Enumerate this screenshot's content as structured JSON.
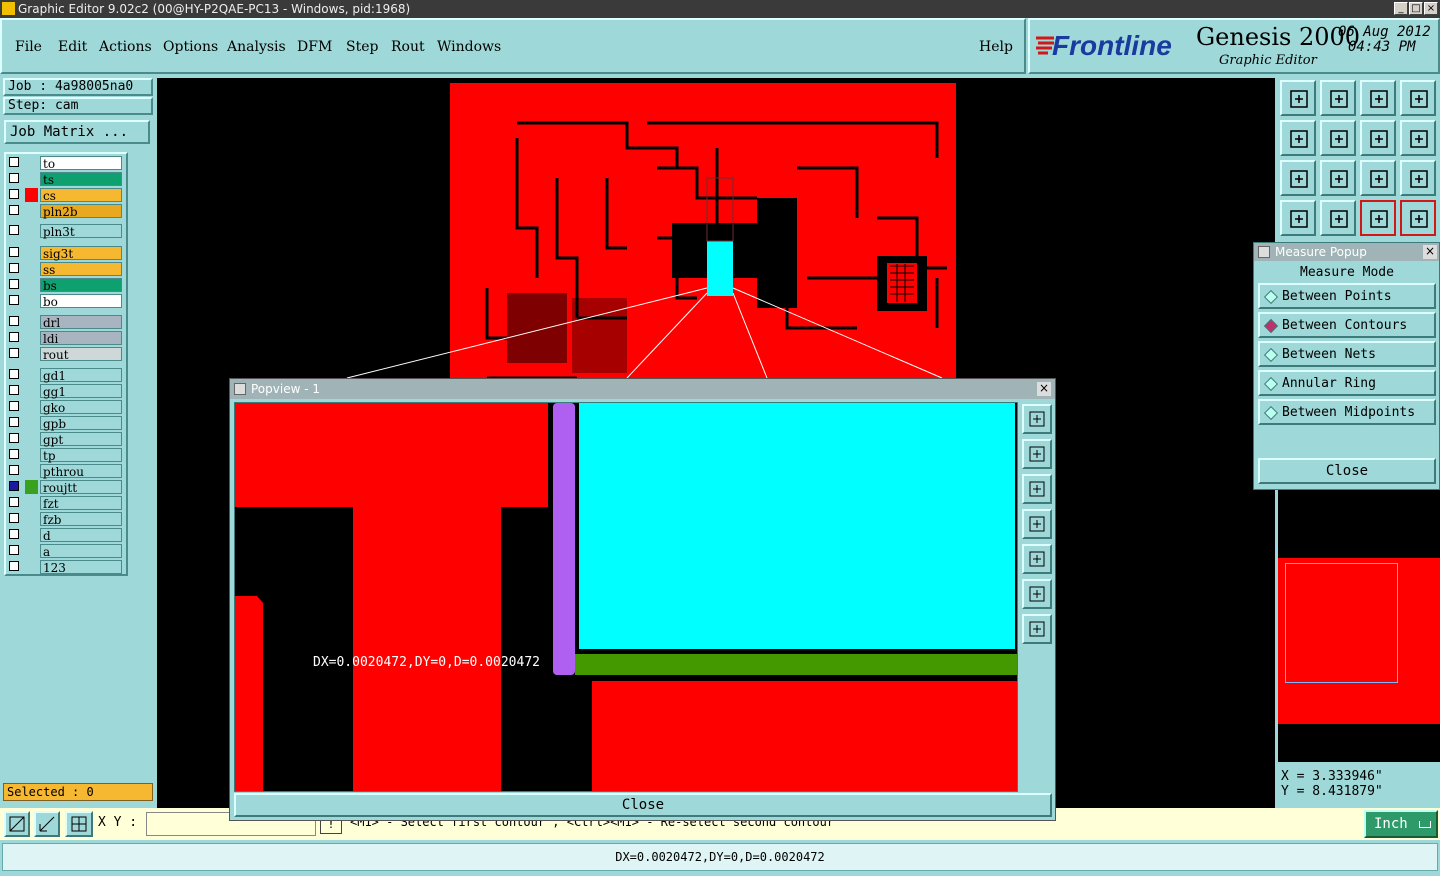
{
  "window": {
    "title": "Graphic Editor 9.02c2 (00@HY-P2QAE-PC13 - Windows, pid:1968)",
    "min": "_",
    "max": "□",
    "close": "×"
  },
  "menu": [
    "File",
    "Edit",
    "Actions",
    "Options",
    "Analysis",
    "DFM",
    "Step",
    "Rout",
    "Windows"
  ],
  "help": "Help",
  "brand": {
    "logo": "Frontline",
    "product": "Genesis 2000",
    "subtitle": "Graphic Editor",
    "date": "06 Aug 2012",
    "time": "04:43 PM"
  },
  "job": {
    "job": "Job : 4a98005na0",
    "step": "Step: cam",
    "matrix": "Job Matrix ..."
  },
  "layers": [
    {
      "name": "to",
      "color": "#ffffff",
      "ind": ""
    },
    {
      "name": "ts",
      "color": "#0fa070",
      "ind": ""
    },
    {
      "name": "cs",
      "color": "#f5b830",
      "ind": "#ff0000"
    },
    {
      "name": "pln2b",
      "color": "#e8a820",
      "ind": ""
    },
    {
      "name": "pln3t",
      "color": "#9fd8d8",
      "ind": ""
    },
    {
      "name": "sig3t",
      "color": "#f5b830",
      "ind": ""
    },
    {
      "name": "ss",
      "color": "#f5b830",
      "ind": ""
    },
    {
      "name": "bs",
      "color": "#0fa070",
      "ind": ""
    },
    {
      "name": "bo",
      "color": "#ffffff",
      "ind": ""
    },
    {
      "name": "drl",
      "color": "#a8b4c0",
      "ind": ""
    },
    {
      "name": "ldi",
      "color": "#a8b4c0",
      "ind": ""
    },
    {
      "name": "rout",
      "color": "#cfd8d8",
      "ind": ""
    },
    {
      "name": "gd1",
      "color": "#9fd8d8",
      "ind": ""
    },
    {
      "name": "gg1",
      "color": "#9fd8d8",
      "ind": ""
    },
    {
      "name": "gko",
      "color": "#9fd8d8",
      "ind": ""
    },
    {
      "name": "gpb",
      "color": "#9fd8d8",
      "ind": ""
    },
    {
      "name": "gpt",
      "color": "#9fd8d8",
      "ind": ""
    },
    {
      "name": "tp",
      "color": "#9fd8d8",
      "ind": ""
    },
    {
      "name": "pthrou",
      "color": "#9fd8d8",
      "ind": ""
    },
    {
      "name": "roujtt",
      "color": "#9fd8d8",
      "ind": "#3aa020"
    },
    {
      "name": "fzt",
      "color": "#9fd8d8",
      "ind": ""
    },
    {
      "name": "fzb",
      "color": "#9fd8d8",
      "ind": ""
    },
    {
      "name": "d",
      "color": "#9fd8d8",
      "ind": ""
    },
    {
      "name": "a",
      "color": "#9fd8d8",
      "ind": ""
    },
    {
      "name": "123",
      "color": "#9fd8d8",
      "ind": ""
    }
  ],
  "selected": "Selected : 0",
  "xy_label": "X Y :",
  "prompt": "<M1> - Select first contour ; <Ctrl><M1> - Re-select second contour",
  "units": "Inch",
  "status": "DX=0.0020472,DY=0,D=0.0020472",
  "measure": {
    "title": "Measure Popup",
    "mode": "Measure Mode",
    "options": [
      "Between Points",
      "Between Contours",
      "Between Nets",
      "Annular Ring",
      "Between Midpoints"
    ],
    "selected": "Between Contours",
    "close": "Close"
  },
  "popview": {
    "title": "Popview - 1",
    "measure": "DX=0.0020472,DY=0,D=0.0020472",
    "close": "Close"
  },
  "coords": {
    "x": "X = 3.333946\"",
    "y": "Y = 8.431879\""
  }
}
